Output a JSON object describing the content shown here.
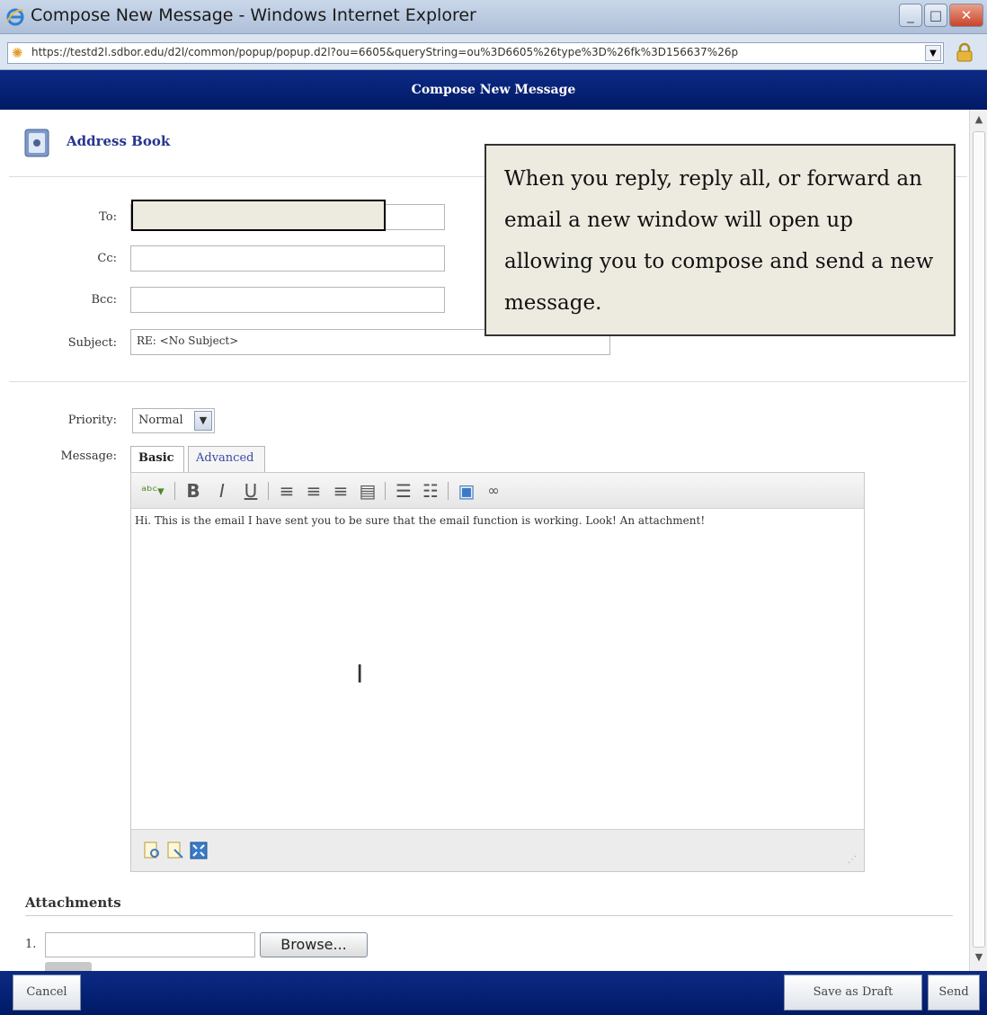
{
  "window": {
    "title": "Compose New Message - Windows Internet Explorer",
    "url": "https://testd2l.sdbor.edu/d2l/common/popup/popup.d2l?ou=6605&queryString=ou%3D6605%26type%3D%26fk%3D156637%26p"
  },
  "header": {
    "title": "Compose New Message"
  },
  "address_book": {
    "label": "Address Book"
  },
  "fields": {
    "to_label": "To:",
    "cc_label": "Cc:",
    "bcc_label": "Bcc:",
    "subject_label": "Subject:",
    "subject_value": "RE: <No Subject>",
    "priority_label": "Priority:",
    "priority_value": "Normal",
    "message_label": "Message:"
  },
  "callout": {
    "text": "When you reply, reply all, or forward an email a new window will open up allowing you to compose and send a new message."
  },
  "editor": {
    "tabs": [
      "Basic",
      "Advanced"
    ],
    "message_body": "Hi.  This is the email I have sent you to be sure that the email function is working.  Look!  An attachment!"
  },
  "attachments": {
    "title": "Attachments",
    "number": "1.",
    "browse_label": "Browse..."
  },
  "footer": {
    "cancel_label": "Cancel",
    "save_draft_label": "Save as Draft",
    "send_label": "Send"
  },
  "colors": {
    "header_blue": "#0d2a84",
    "callout_bg": "#edeae0",
    "link_blue": "#26348f"
  }
}
